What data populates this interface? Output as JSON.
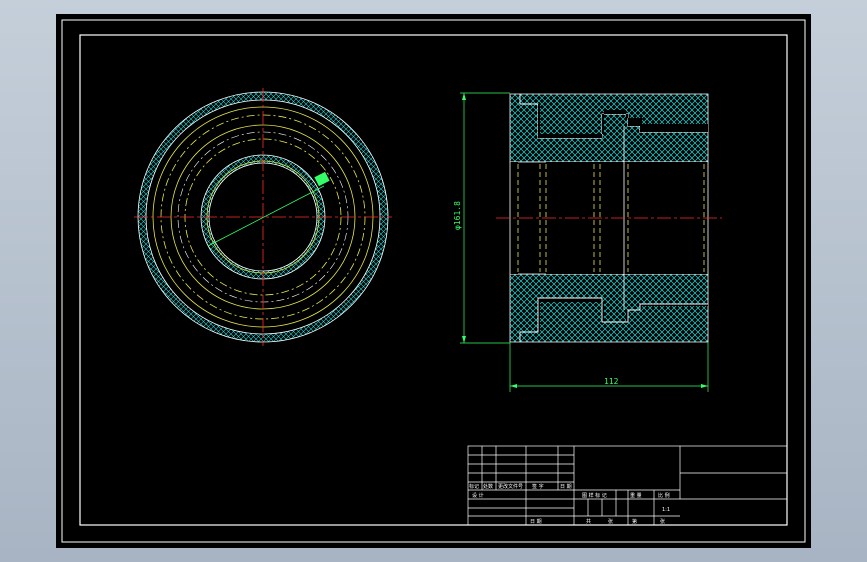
{
  "drawing": {
    "dimensions": {
      "diameter": "φ161.8",
      "length": "112"
    },
    "title_block": {
      "row1": [
        "标记",
        "处数",
        "更改文件号",
        "签 字",
        "日 期"
      ],
      "row2": [
        "设 计"
      ],
      "right_row1": [
        "图 样 标 记",
        "重 量",
        "比 例"
      ],
      "scale": "1:1",
      "row3_left": [
        "审 核"
      ],
      "row3_mid": [
        "工 艺"
      ],
      "row3_mid2": [
        "日 期"
      ],
      "bottom_right": [
        "共",
        "张",
        "第",
        "张"
      ]
    }
  }
}
